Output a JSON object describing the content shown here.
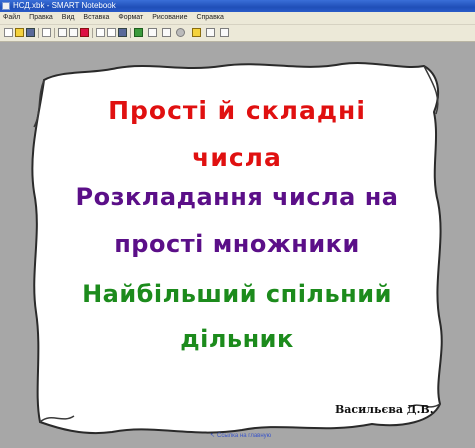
{
  "window": {
    "title": "НСД.xbk - SMART Notebook"
  },
  "menubar": {
    "items": [
      "Файл",
      "Правка",
      "Вид",
      "Вставка",
      "Формат",
      "Рисование",
      "Справка"
    ]
  },
  "toolbar": {
    "icons": [
      "new-icon",
      "open-icon",
      "save-icon",
      "paste-icon",
      "undo-icon",
      "redo-icon",
      "delete-icon",
      "screen-icon",
      "fullscreen-icon",
      "table-icon",
      "pen-icon",
      "eraser-icon",
      "line-icon",
      "shape-icon",
      "fill-icon",
      "text-icon",
      "more-icon"
    ]
  },
  "slide": {
    "title_line1": "Прості й складні",
    "title_line2": "числа",
    "sub_line1": "Розкладання числа на",
    "sub_line2": "прості множники",
    "gcd_line1": "Найбільший спільний",
    "gcd_line2": "дільник",
    "author": "Васильєва Д.В."
  },
  "footer": {
    "link": "Ссылка на главную"
  },
  "colors": {
    "title": "#e01010",
    "subtitle": "#5b0f88",
    "gcd": "#1c8b1c",
    "titlebar": "#2a5bc8"
  }
}
